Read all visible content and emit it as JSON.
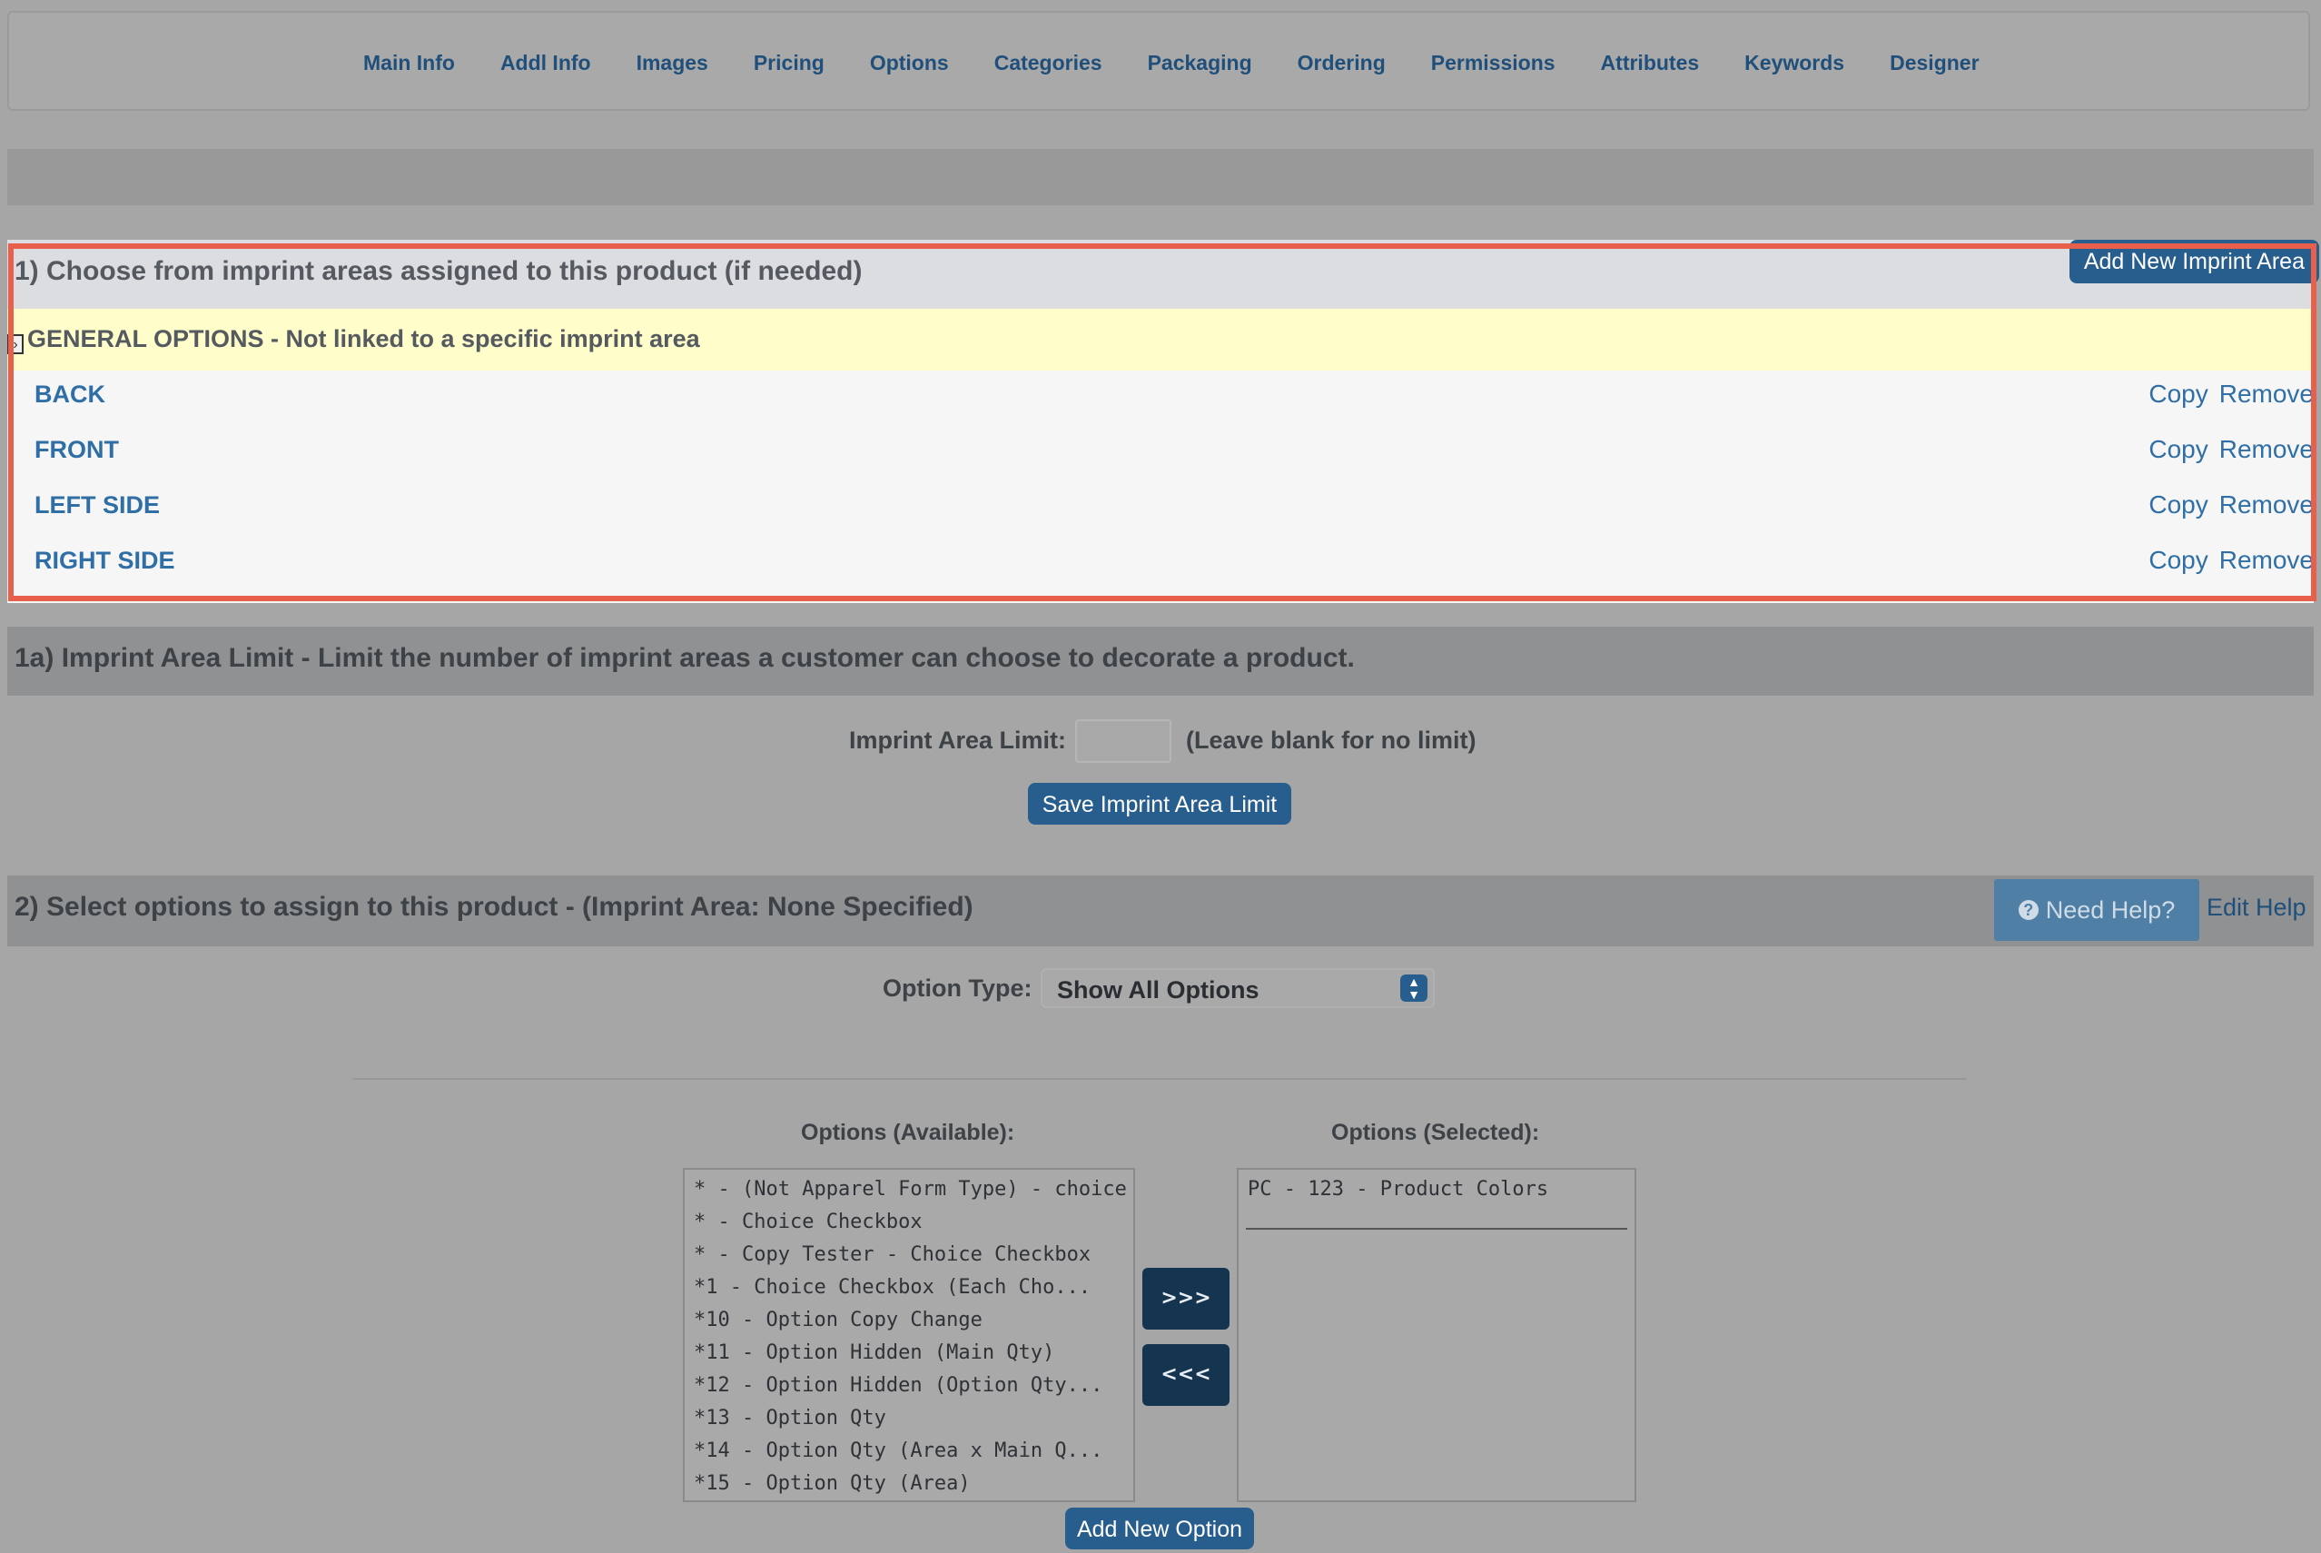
{
  "tabs": [
    "Main Info",
    "Addl Info",
    "Images",
    "Pricing",
    "Options",
    "Categories",
    "Packaging",
    "Ordering",
    "Permissions",
    "Attributes",
    "Keywords",
    "Designer"
  ],
  "section1": {
    "title": "1) Choose from imprint areas assigned to this product (if needed)",
    "add_button": "Add New Imprint Area",
    "general": "GENERAL OPTIONS - Not linked to a specific imprint area",
    "areas": [
      {
        "name": "BACK",
        "copy": "Copy",
        "remove": "Remove"
      },
      {
        "name": "FRONT",
        "copy": "Copy",
        "remove": "Remove"
      },
      {
        "name": "LEFT SIDE",
        "copy": "Copy",
        "remove": "Remove"
      },
      {
        "name": "RIGHT SIDE",
        "copy": "Copy",
        "remove": "Remove"
      }
    ]
  },
  "section1a": {
    "title": "1a) Imprint Area Limit - Limit the number of imprint areas a customer can choose to decorate a product.",
    "label": "Imprint Area Limit:",
    "value": "",
    "hint": "(Leave blank for no limit)",
    "save_button": "Save Imprint Area Limit"
  },
  "section2": {
    "title": "2) Select options to assign to this product - (Imprint Area: None Specified)",
    "need_help": "Need Help?",
    "edit_help": "Edit Help",
    "option_type_label": "Option Type:",
    "option_type_value": "Show All Options",
    "available_label": "Options (Available):",
    "selected_label": "Options (Selected):",
    "available": [
      "* - (Not Apparel Form Type) - choice qty",
      "* - Choice Checkbox",
      "* - Copy Tester - Choice Checkbox",
      "*1 - Choice Checkbox (Each Cho...",
      "*10 - Option Copy Change",
      "*11 - Option Hidden (Main Qty)",
      "*12 - Option Hidden (Option Qty...",
      "*13 - Option Qty",
      "*14 - Option Qty (Area x Main Q...",
      "*15 - Option Qty (Area)"
    ],
    "selected": [
      "PC - 123 - Product Colors"
    ],
    "move_right": ">>>",
    "move_left": "<<<",
    "add_option": "Add New Option"
  }
}
